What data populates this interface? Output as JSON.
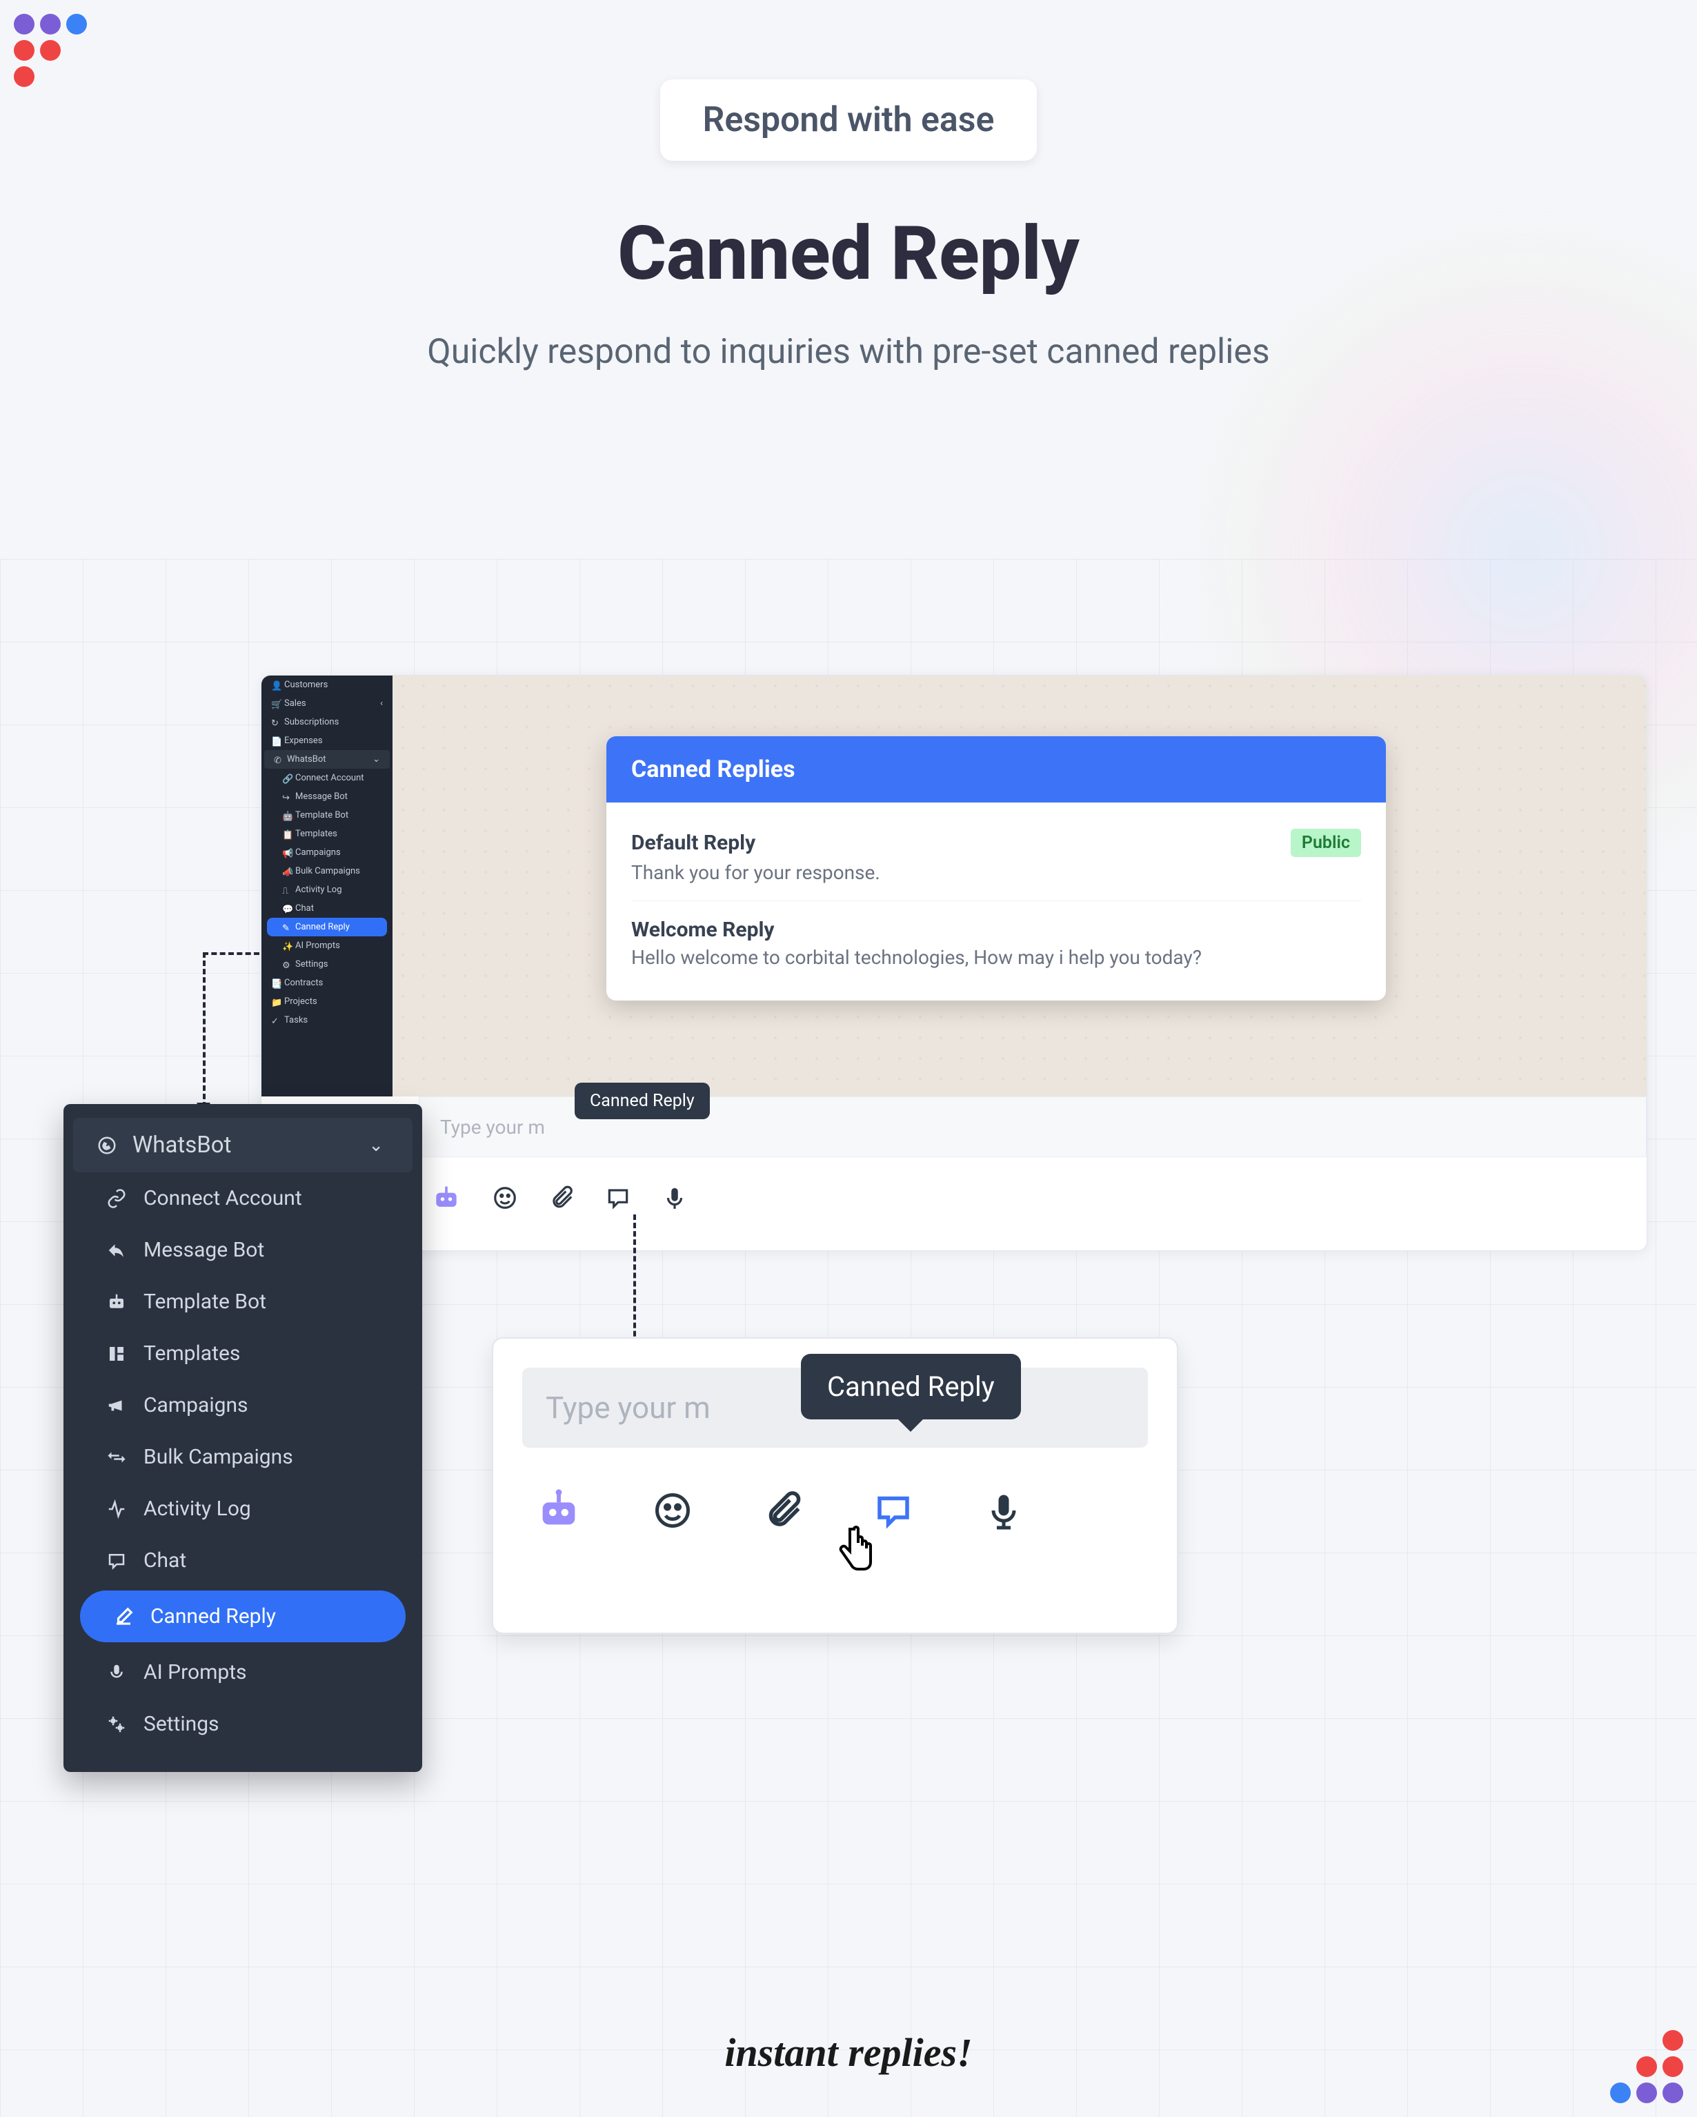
{
  "header": {
    "pill": "Respond with ease",
    "title": "Canned Reply",
    "subtitle": "Quickly respond to inquiries with pre-set canned replies"
  },
  "mini_sidebar": {
    "customers": "Customers",
    "sales": "Sales",
    "subscriptions": "Subscriptions",
    "expenses": "Expenses",
    "whatsbot": "WhatsBot",
    "connect": "Connect Account",
    "msgbot": "Message Bot",
    "tplbot": "Template Bot",
    "templates": "Templates",
    "campaigns": "Campaigns",
    "bulk": "Bulk Campaigns",
    "activity": "Activity Log",
    "chat": "Chat",
    "canned": "Canned Reply",
    "aiprompts": "AI Prompts",
    "settings": "Settings",
    "contracts": "Contracts",
    "projects": "Projects",
    "tasks": "Tasks"
  },
  "big_sidebar": {
    "group": "WhatsBot",
    "connect": "Connect Account",
    "msgbot": "Message Bot",
    "tplbot": "Template Bot",
    "templates": "Templates",
    "campaigns": "Campaigns",
    "bulk": "Bulk Campaigns",
    "activity": "Activity Log",
    "chat": "Chat",
    "canned": "Canned Reply",
    "aiprompts": "AI Prompts",
    "settings": "Settings"
  },
  "canned": {
    "header": "Canned Replies",
    "items": [
      {
        "title": "Default Reply",
        "text": "Thank you for your response.",
        "tag": "Public"
      },
      {
        "title": "Welcome Reply",
        "text": "Hello welcome to corbital technologies, How may i help you today?",
        "tag": ""
      }
    ]
  },
  "composer": {
    "placeholder_short": "Type your m",
    "placeholder_long": "Type your m",
    "tooltip": "Canned Reply"
  },
  "footer": "instant replies!"
}
